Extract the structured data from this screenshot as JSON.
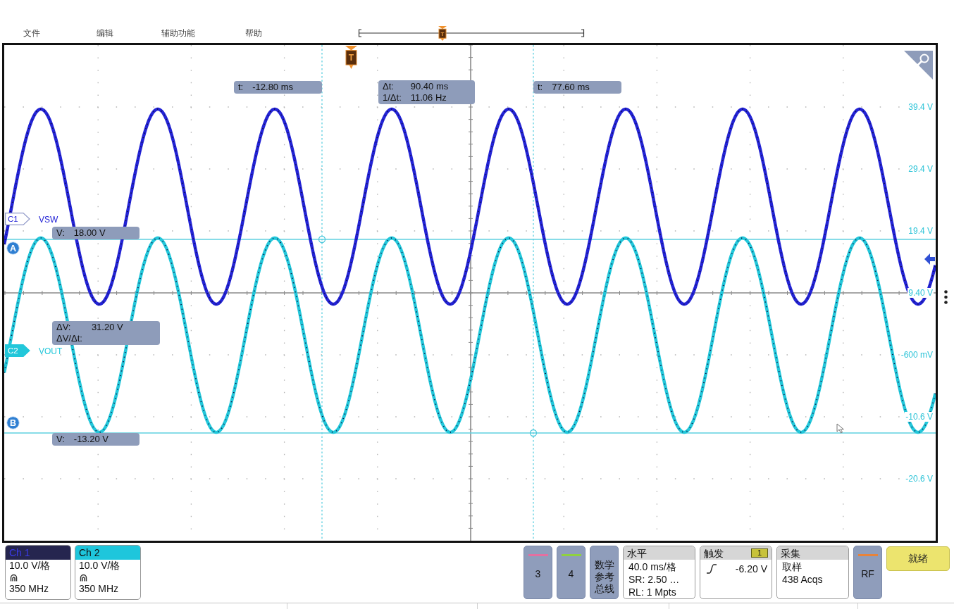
{
  "menu": [
    "文件",
    "编辑",
    "辅助功能",
    "帮助"
  ],
  "record_overview": {
    "trigger_label": "T"
  },
  "plot": {
    "trigger_label": "T",
    "cursor_readouts": {
      "time_cursor_a": [
        {
          "label": "t:",
          "value": "-12.80 ms"
        }
      ],
      "time_delta": [
        {
          "label": "Δt:",
          "value": "90.40 ms"
        },
        {
          "label": "1/Δt:",
          "value": "11.06 Hz"
        }
      ],
      "time_cursor_b": [
        {
          "label": "t:",
          "value": "77.60 ms"
        }
      ],
      "volt_cursor_a": [
        {
          "label": "V:",
          "value": "18.00 V"
        }
      ],
      "volt_delta": [
        {
          "label": "ΔV:",
          "value": "31.20 V"
        },
        {
          "label": "ΔV/Δt:"
        }
      ],
      "volt_cursor_b": [
        {
          "label": "V:",
          "value": "-13.20 V"
        }
      ]
    },
    "traces": [
      {
        "tag": "C1",
        "name": "VSW",
        "kind": "outline",
        "color": "#2323d6"
      },
      {
        "tag": "C2",
        "name": "VOUT",
        "kind": "filled",
        "color": "#22c7da"
      }
    ],
    "cursor_markers": [
      "A",
      "B"
    ],
    "axis_labels": [
      "39.4 V",
      "29.4 V",
      "19.4 V",
      "9.40 V",
      "-600 mV",
      "-10.6 V",
      "-20.6 V"
    ]
  },
  "bottom_bar": {
    "channels": [
      {
        "name": "Ch 1",
        "scale": "10.0 V/格",
        "bandwidth": "350 MHz",
        "color": "#25254f",
        "selected": true
      },
      {
        "name": "Ch 2",
        "scale": "10.0 V/格",
        "bandwidth": "350 MHz",
        "color": "#1ec6dc",
        "selected": false
      }
    ],
    "controls": [
      {
        "kind": "channel_button",
        "label": "3",
        "color": "#e46fa0"
      },
      {
        "kind": "channel_button",
        "label": "4",
        "color": "#8fd13f"
      },
      {
        "kind": "menu_button",
        "lines": [
          "数学",
          "参考",
          "总线"
        ]
      },
      {
        "kind": "panel",
        "title": "水平",
        "lines": [
          "40.0 ms/格",
          "SR: 2.50 …",
          "RL: 1 Mpts"
        ]
      },
      {
        "kind": "trigger_panel",
        "title": "触发",
        "source": "1",
        "level": "-6.20 V"
      },
      {
        "kind": "panel",
        "title": "采集",
        "lines": [
          "取样",
          "438 Acqs"
        ]
      },
      {
        "kind": "channel_button",
        "label": "RF",
        "color": "#e8833a"
      },
      {
        "kind": "status_button",
        "label": "就绪"
      }
    ]
  }
}
